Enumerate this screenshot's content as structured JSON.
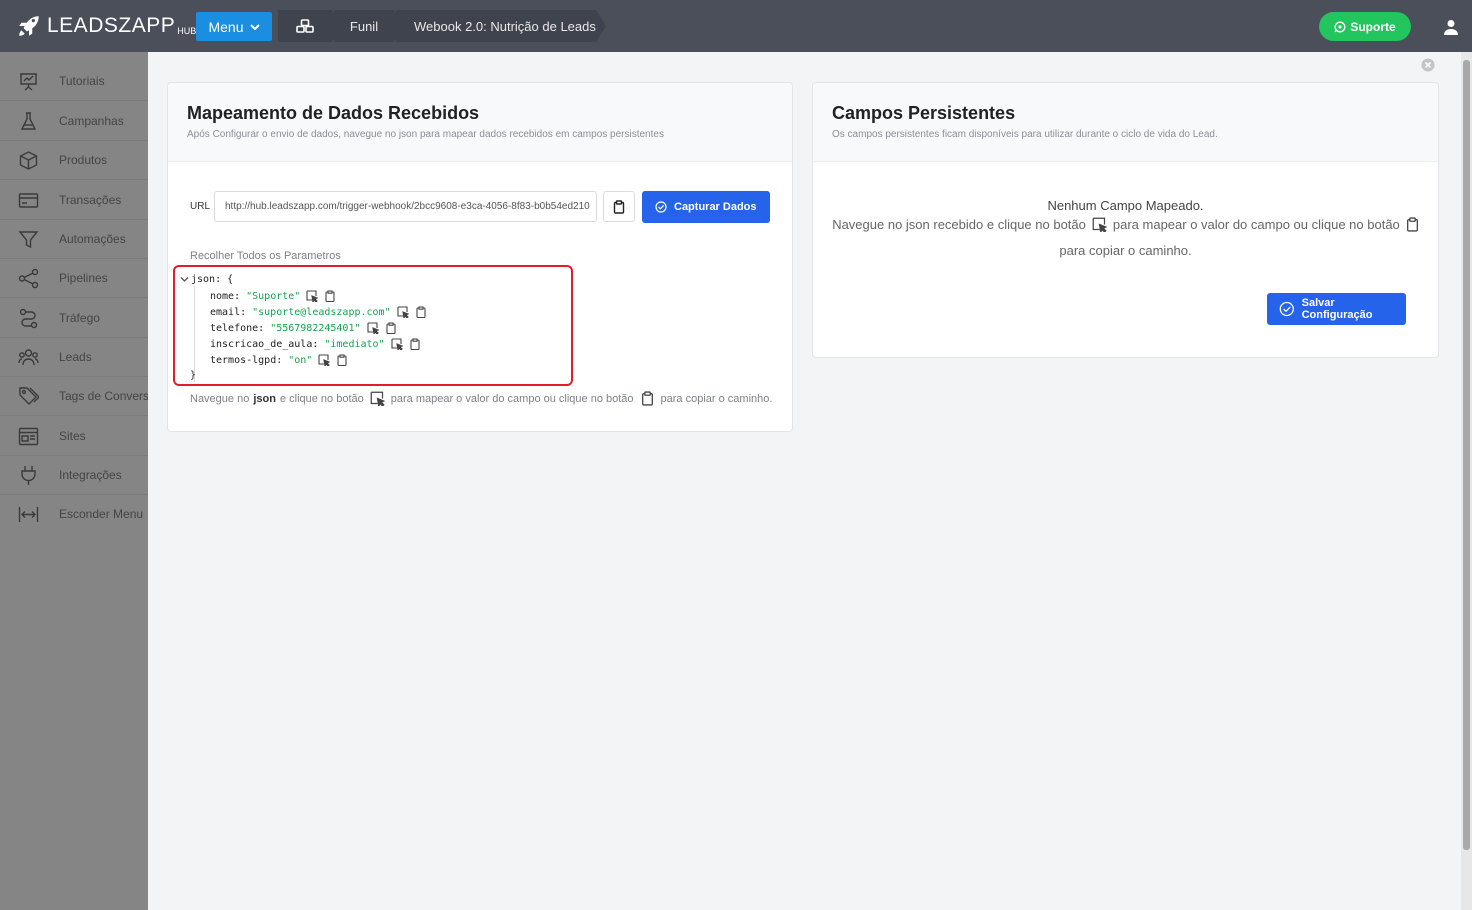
{
  "header": {
    "logo_text": "LEADSZAPP",
    "logo_sub": "HUB",
    "menu_label": "Menu",
    "breadcrumbs": [
      "Funil",
      "Webook 2.0: Nutrição de Leads"
    ],
    "support_label": "Suporte"
  },
  "sidebar": {
    "items": [
      {
        "label": "Tutoriais",
        "icon": "presentation-icon"
      },
      {
        "label": "Campanhas",
        "icon": "flask-icon"
      },
      {
        "label": "Produtos",
        "icon": "box-icon"
      },
      {
        "label": "Transações",
        "icon": "credit-card-icon"
      },
      {
        "label": "Automações",
        "icon": "filter-icon"
      },
      {
        "label": "Pipelines",
        "icon": "share-icon"
      },
      {
        "label": "Tráfego",
        "icon": "route-icon"
      },
      {
        "label": "Leads",
        "icon": "users-icon"
      },
      {
        "label": "Tags de Conversão",
        "icon": "tags-icon"
      },
      {
        "label": "Sites",
        "icon": "window-icon"
      },
      {
        "label": "Integrações",
        "icon": "plug-icon"
      },
      {
        "label": "Esconder Menu",
        "icon": "collapse-icon"
      }
    ]
  },
  "mapping": {
    "title": "Mapeamento de Dados Recebidos",
    "subtitle": "Após Configurar o envio de dados, navegue no json para mapear dados recebidos em campos persistentes",
    "url_label": "URL",
    "url_value": "http://hub.leadszapp.com/trigger-webhook/2bcc9608-e3ca-4056-8f83-b0b54ed210",
    "capture_label": "Capturar Dados",
    "collapse_label": "Recolher Todos os Parametros",
    "json_root": "json: {",
    "json_close": "}",
    "json_fields": [
      {
        "key": "nome:",
        "value": "\"Suporte\""
      },
      {
        "key": "email:",
        "value": "\"suporte@leadszapp.com\""
      },
      {
        "key": "telefone:",
        "value": "\"5567982245401\""
      },
      {
        "key": "inscricao_de_aula:",
        "value": "\"imediato\""
      },
      {
        "key": "termos-lgpd:",
        "value": "\"on\""
      }
    ],
    "help_prefix": "Navegue no",
    "help_json": "json",
    "help_mid1": "e clique no botão",
    "help_mid2": "para mapear o valor do campo ou clique no botão",
    "help_end": "para copiar o caminho."
  },
  "persistent": {
    "title": "Campos Persistentes",
    "subtitle": "Os campos persistentes ficam disponíveis para utilizar durante o ciclo de vida do Lead.",
    "empty_title": "Nenhum Campo Mapeado.",
    "empty_part1": "Navegue no json recebido e clique no botão",
    "empty_part2": "para mapear o valor do campo ou clique no botão",
    "empty_part3": "para copiar o caminho.",
    "save_label": "Salvar Configuração"
  },
  "colors": {
    "topbar": "#4a4f5a",
    "accent": "#2563eb",
    "support": "#22c55e",
    "highlight": "#e11d2a"
  }
}
